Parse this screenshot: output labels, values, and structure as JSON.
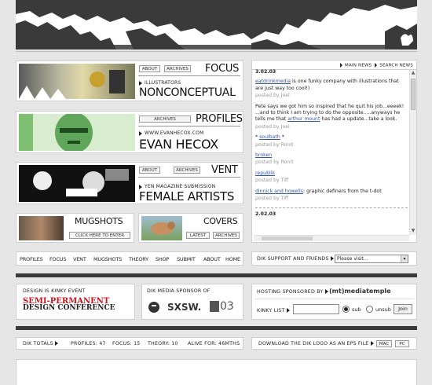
{
  "header": {
    "map_alt": "world map banner"
  },
  "features": [
    {
      "pill1": "ABOUT",
      "pill2": "ARCHIVES",
      "title": "FOCUS",
      "sub": "ILLUSTRATORS",
      "big": "NONCONCEPTUAL"
    },
    {
      "pill1": "ARCHIVES",
      "title": "PROFILES",
      "sub": "WWW.EVANHECOX.COM",
      "big": "EVAN HECOX"
    },
    {
      "pill1": "ABOUT",
      "pill2": "ARCHIVES",
      "title": "VENT",
      "sub": "YEN MAGAZINE SUBMISSION",
      "big": "FEMALE ARTISTS"
    }
  ],
  "mugshots": {
    "title": "MUGSHOTS",
    "button": "CLICK HERE TO ENTER"
  },
  "covers": {
    "title": "COVERS",
    "pill1": "LATEST",
    "pill2": "ARCHIVES"
  },
  "news_nav": {
    "main": "MAIN NEWS",
    "search": "SEARCH NEWS"
  },
  "blog": {
    "date1": "3.02.03",
    "p1_link": "eatdrinkmedia",
    "p1_text": " is one funky company with illustrations that are just way too cool!)",
    "p1_by": "posted by Joel",
    "p2_text1": "Pete says we got him so inspired that he quit his job...eeeek! ...and to think I am trying to do the opposite.....anyways he tells me that ",
    "p2_link": "arthur mount",
    "p2_text2": " has had a update...take a look.",
    "p2_by": "posted by Joel",
    "p3_pre": "* ",
    "p3_link": "soulbath",
    "p3_post": " *",
    "p3_by": "posted by Ronit",
    "p4_link": "broken",
    "p4_by": "posted by Ronit",
    "p5_link": "republik",
    "p5_by": "posted by Tiff",
    "p6_link": "dinnick and howells",
    "p6_text": ": graphic definers from the t-dot",
    "p6_by": "posted by Tiff",
    "date2": "2.02.03"
  },
  "nav": [
    "PROFILES",
    "FOCUS",
    "VENT",
    "MUGSHOTS",
    "THEORY",
    "SHOP",
    "SUBMIT",
    "ABOUT",
    "HOME"
  ],
  "support": {
    "label": "DIK SUPPORT AND FRIENDS",
    "select": "Please visit..."
  },
  "kinky": {
    "label": "DESIGN IS KINKY EVENT",
    "line1": "SEMI-PERMANENT",
    "line2": "DESIGN CONFERENCE"
  },
  "sponsor": {
    "label": "DIK MEDIA SPONSOR OF",
    "sxsw": "SXSW.",
    "o3": "03"
  },
  "hosting": {
    "label": "HOSTING SPONSORED BY",
    "brand": "(mt)mediatemple",
    "kinky_list": "KINKY LIST",
    "sub": "sub",
    "unsub": "unsub",
    "join": "Join"
  },
  "totals": {
    "label": "DIK TOTALS",
    "profiles": "PROFILES: 47",
    "focus": "FOCUS: 15",
    "theory": "THEORY: 10",
    "alive": "ALIVE FOR: 46MTHS"
  },
  "logo": {
    "label": "DOWNLOAD THE DIK LOGO AS AN EPS FILE",
    "mac": "MAC",
    "pc": "PC"
  },
  "colors": {
    "brand_red": "#c8161d",
    "link": "#3355aa",
    "dark": "#3a3a3a"
  }
}
